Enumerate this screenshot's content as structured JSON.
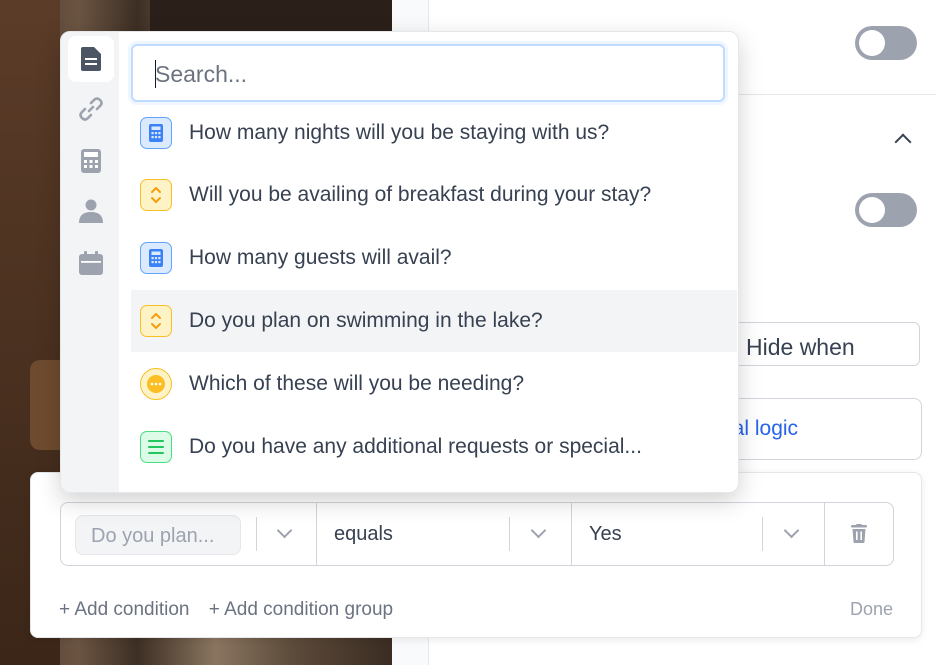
{
  "background": {
    "hide_when_label": "Hide when",
    "logic_button_label": "nal logic"
  },
  "popup": {
    "sidebar_icons": [
      "document-icon",
      "link-icon",
      "calculator-icon",
      "person-icon",
      "calendar-icon"
    ],
    "search": {
      "placeholder": "Search...",
      "value": ""
    },
    "options": [
      {
        "icon": "calculator-icon",
        "label": "How many nights will you be staying with us?"
      },
      {
        "icon": "yes-no-icon",
        "label": "Will you be availing of breakfast during your stay?"
      },
      {
        "icon": "calculator-icon",
        "label": "How many guests will avail?"
      },
      {
        "icon": "yes-no-icon",
        "label": "Do you plan on swimming in the lake?"
      },
      {
        "icon": "multiple-choice-icon",
        "label": "Which of these will you be needing?"
      },
      {
        "icon": "long-text-icon",
        "label": "Do you have any additional requests or special..."
      }
    ]
  },
  "condition": {
    "field_value": "Do you plan...",
    "operator_value": "equals",
    "answer_value": "Yes",
    "add_condition_label": "+ Add condition",
    "add_group_label": "+ Add condition group",
    "done_label": "Done"
  },
  "colors": {
    "accent": "#2563eb",
    "calc_icon_bg": "#dbeafe",
    "yesno_icon_bg": "#fef3c7",
    "text_icon_bg": "#dcfce7",
    "toggle_off": "#9ca3af"
  }
}
